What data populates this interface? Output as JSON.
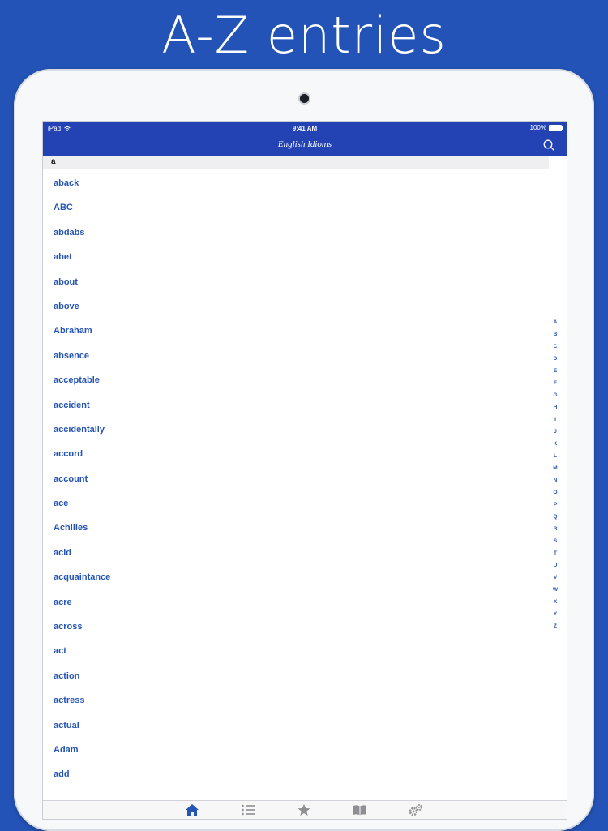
{
  "headline": "A-Z entries",
  "status_bar": {
    "device": "iPad",
    "time": "9:41 AM",
    "battery": "100%"
  },
  "nav": {
    "title": "English Idioms"
  },
  "section": {
    "letter": "a"
  },
  "entries": [
    "aback",
    "ABC",
    "abdabs",
    "abet",
    "about",
    "above",
    "Abraham",
    "absence",
    "acceptable",
    "accident",
    "accidentally",
    "accord",
    "account",
    "ace",
    "Achilles",
    "acid",
    "acquaintance",
    "acre",
    "across",
    "act",
    "action",
    "actress",
    "actual",
    "Adam",
    "add"
  ],
  "index_letters": [
    "A",
    "B",
    "C",
    "D",
    "E",
    "F",
    "G",
    "H",
    "I",
    "J",
    "K",
    "L",
    "M",
    "N",
    "O",
    "P",
    "Q",
    "R",
    "S",
    "T",
    "U",
    "V",
    "W",
    "X",
    "Y",
    "Z"
  ],
  "tabs": [
    {
      "icon": "home-icon",
      "active": true
    },
    {
      "icon": "list-icon",
      "active": false
    },
    {
      "icon": "star-icon",
      "active": false
    },
    {
      "icon": "book-icon",
      "active": false
    },
    {
      "icon": "gears-icon",
      "active": false
    }
  ],
  "colors": {
    "background": "#2453b8",
    "bar": "#2343b5",
    "link": "#2454b4",
    "tab_active": "#2454b4",
    "tab_inactive": "#8e8e93"
  }
}
